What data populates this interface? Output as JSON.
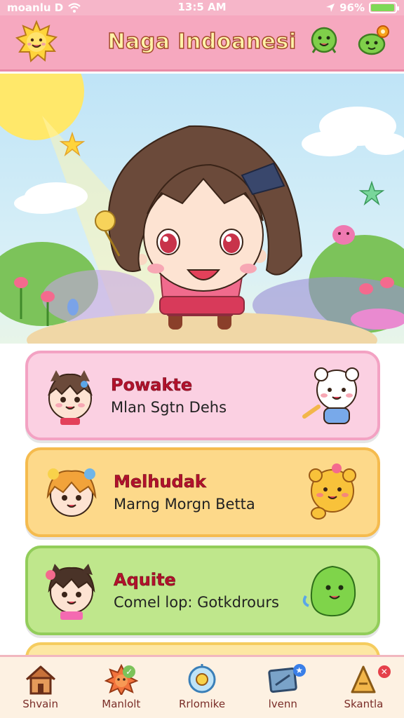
{
  "status_bar": {
    "carrier": "moanlu D",
    "time": "13:5 AM",
    "battery": "96%",
    "battery_level": 0.96
  },
  "header": {
    "title": "Naga Indoanesi",
    "left_icon": "sun-icon",
    "right_icons": [
      "bean-friend-icon",
      "bean-friend-notification-icon"
    ]
  },
  "cards": [
    {
      "title": "Powakte",
      "subtitle": "Mlan Sgtn Dehs",
      "color": "#fbd0e2"
    },
    {
      "title": "Melhudak",
      "subtitle": "Marng Morgn Betta",
      "color": "#fdd98a"
    },
    {
      "title": "Aquite",
      "subtitle": "Comel lop: Gotkdrours",
      "color": "#bfe78c"
    }
  ],
  "nav": [
    {
      "label": "Shvain",
      "icon": "home-icon"
    },
    {
      "label": "Manlolt",
      "icon": "flower-icon"
    },
    {
      "label": "Rrlomike",
      "icon": "bubble-icon"
    },
    {
      "label": "lvenn",
      "icon": "book-icon"
    },
    {
      "label": "Skantla",
      "icon": "cone-icon"
    }
  ]
}
